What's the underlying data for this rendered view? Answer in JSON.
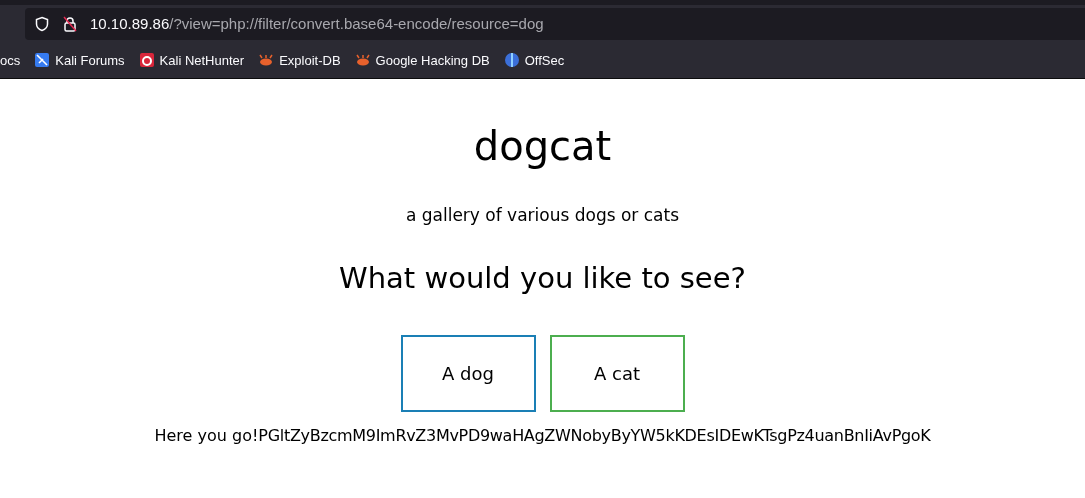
{
  "browser": {
    "url_host": "10.10.89.86",
    "url_path": "/?view=php://filter/convert.base64-encode/resource=dog",
    "bookmarks": [
      {
        "label": "ocs",
        "kind": "plain"
      },
      {
        "label": "Kali Forums",
        "kind": "kali"
      },
      {
        "label": "Kali NetHunter",
        "kind": "nethunter"
      },
      {
        "label": "Exploit-DB",
        "kind": "bug"
      },
      {
        "label": "Google Hacking DB",
        "kind": "bug"
      },
      {
        "label": "OffSec",
        "kind": "offsec"
      }
    ]
  },
  "page": {
    "title": "dogcat",
    "subtitle": "a gallery of various dogs or cats",
    "question": "What would you like to see?",
    "choices": [
      {
        "label": "A dog",
        "color": "#1a7fb5"
      },
      {
        "label": "A cat",
        "color": "#4cae4f"
      }
    ],
    "output_intro": "Here you go!",
    "output": "PGltZyBzcmM9ImRvZ3MvPD9waHAgZWNobyByYW5kKDEsIDEwKTsgPz4uanBnIiAvPgoK"
  }
}
